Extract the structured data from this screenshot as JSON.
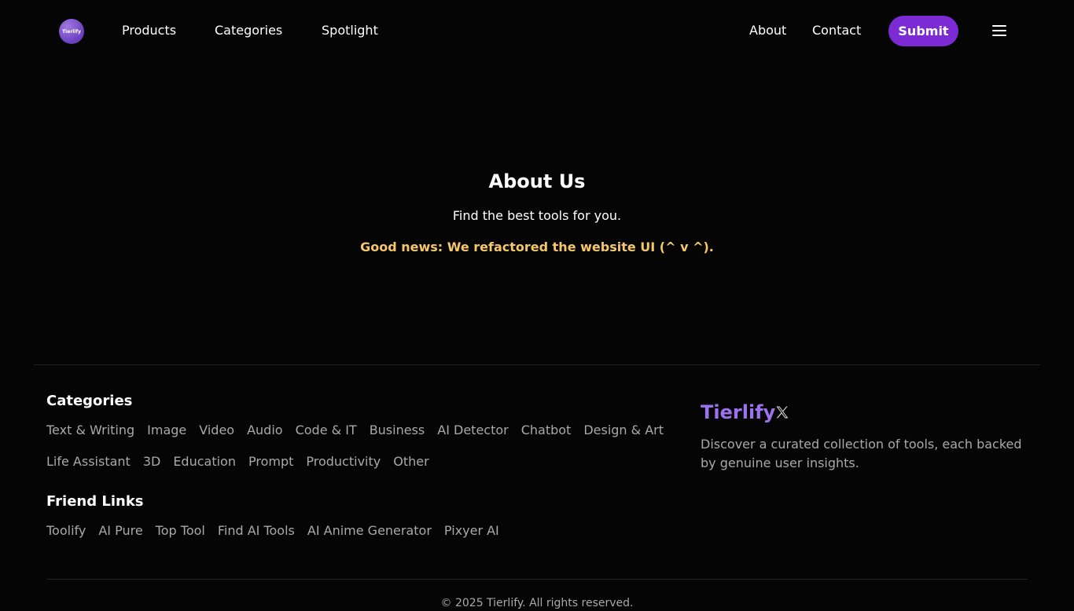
{
  "header": {
    "logo_text": "Tierlify",
    "nav_left": [
      "Products",
      "Categories",
      "Spotlight"
    ],
    "nav_right": [
      "About",
      "Contact"
    ],
    "submit_label": "Submit"
  },
  "hero": {
    "title": "About Us",
    "subtitle": "Find the best tools for you.",
    "news": "Good news: We refactored the website UI (^ v ^)."
  },
  "footer": {
    "categories_title": "Categories",
    "categories_row1": [
      "Text & Writing",
      "Image",
      "Video",
      "Audio",
      "Code & IT",
      "Business",
      "AI Detector",
      "Chatbot",
      "Design & Art"
    ],
    "categories_row2": [
      "Life Assistant",
      "3D",
      "Education",
      "Prompt",
      "Productivity",
      "Other"
    ],
    "friend_links_title": "Friend Links",
    "friend_links": [
      "Toolify",
      "AI Pure",
      "Top Tool",
      "Find AI Tools",
      "AI Anime Generator",
      "Pixyer AI"
    ],
    "brand": "Tierlify",
    "brand_description": "Discover a curated collection of tools, each backed by genuine user insights.",
    "copyright": "© 2025 Tierlify. All rights reserved."
  },
  "colors": {
    "accent": "#7b2ad4",
    "brand": "#9c72ee",
    "news": "#f5c76a"
  }
}
